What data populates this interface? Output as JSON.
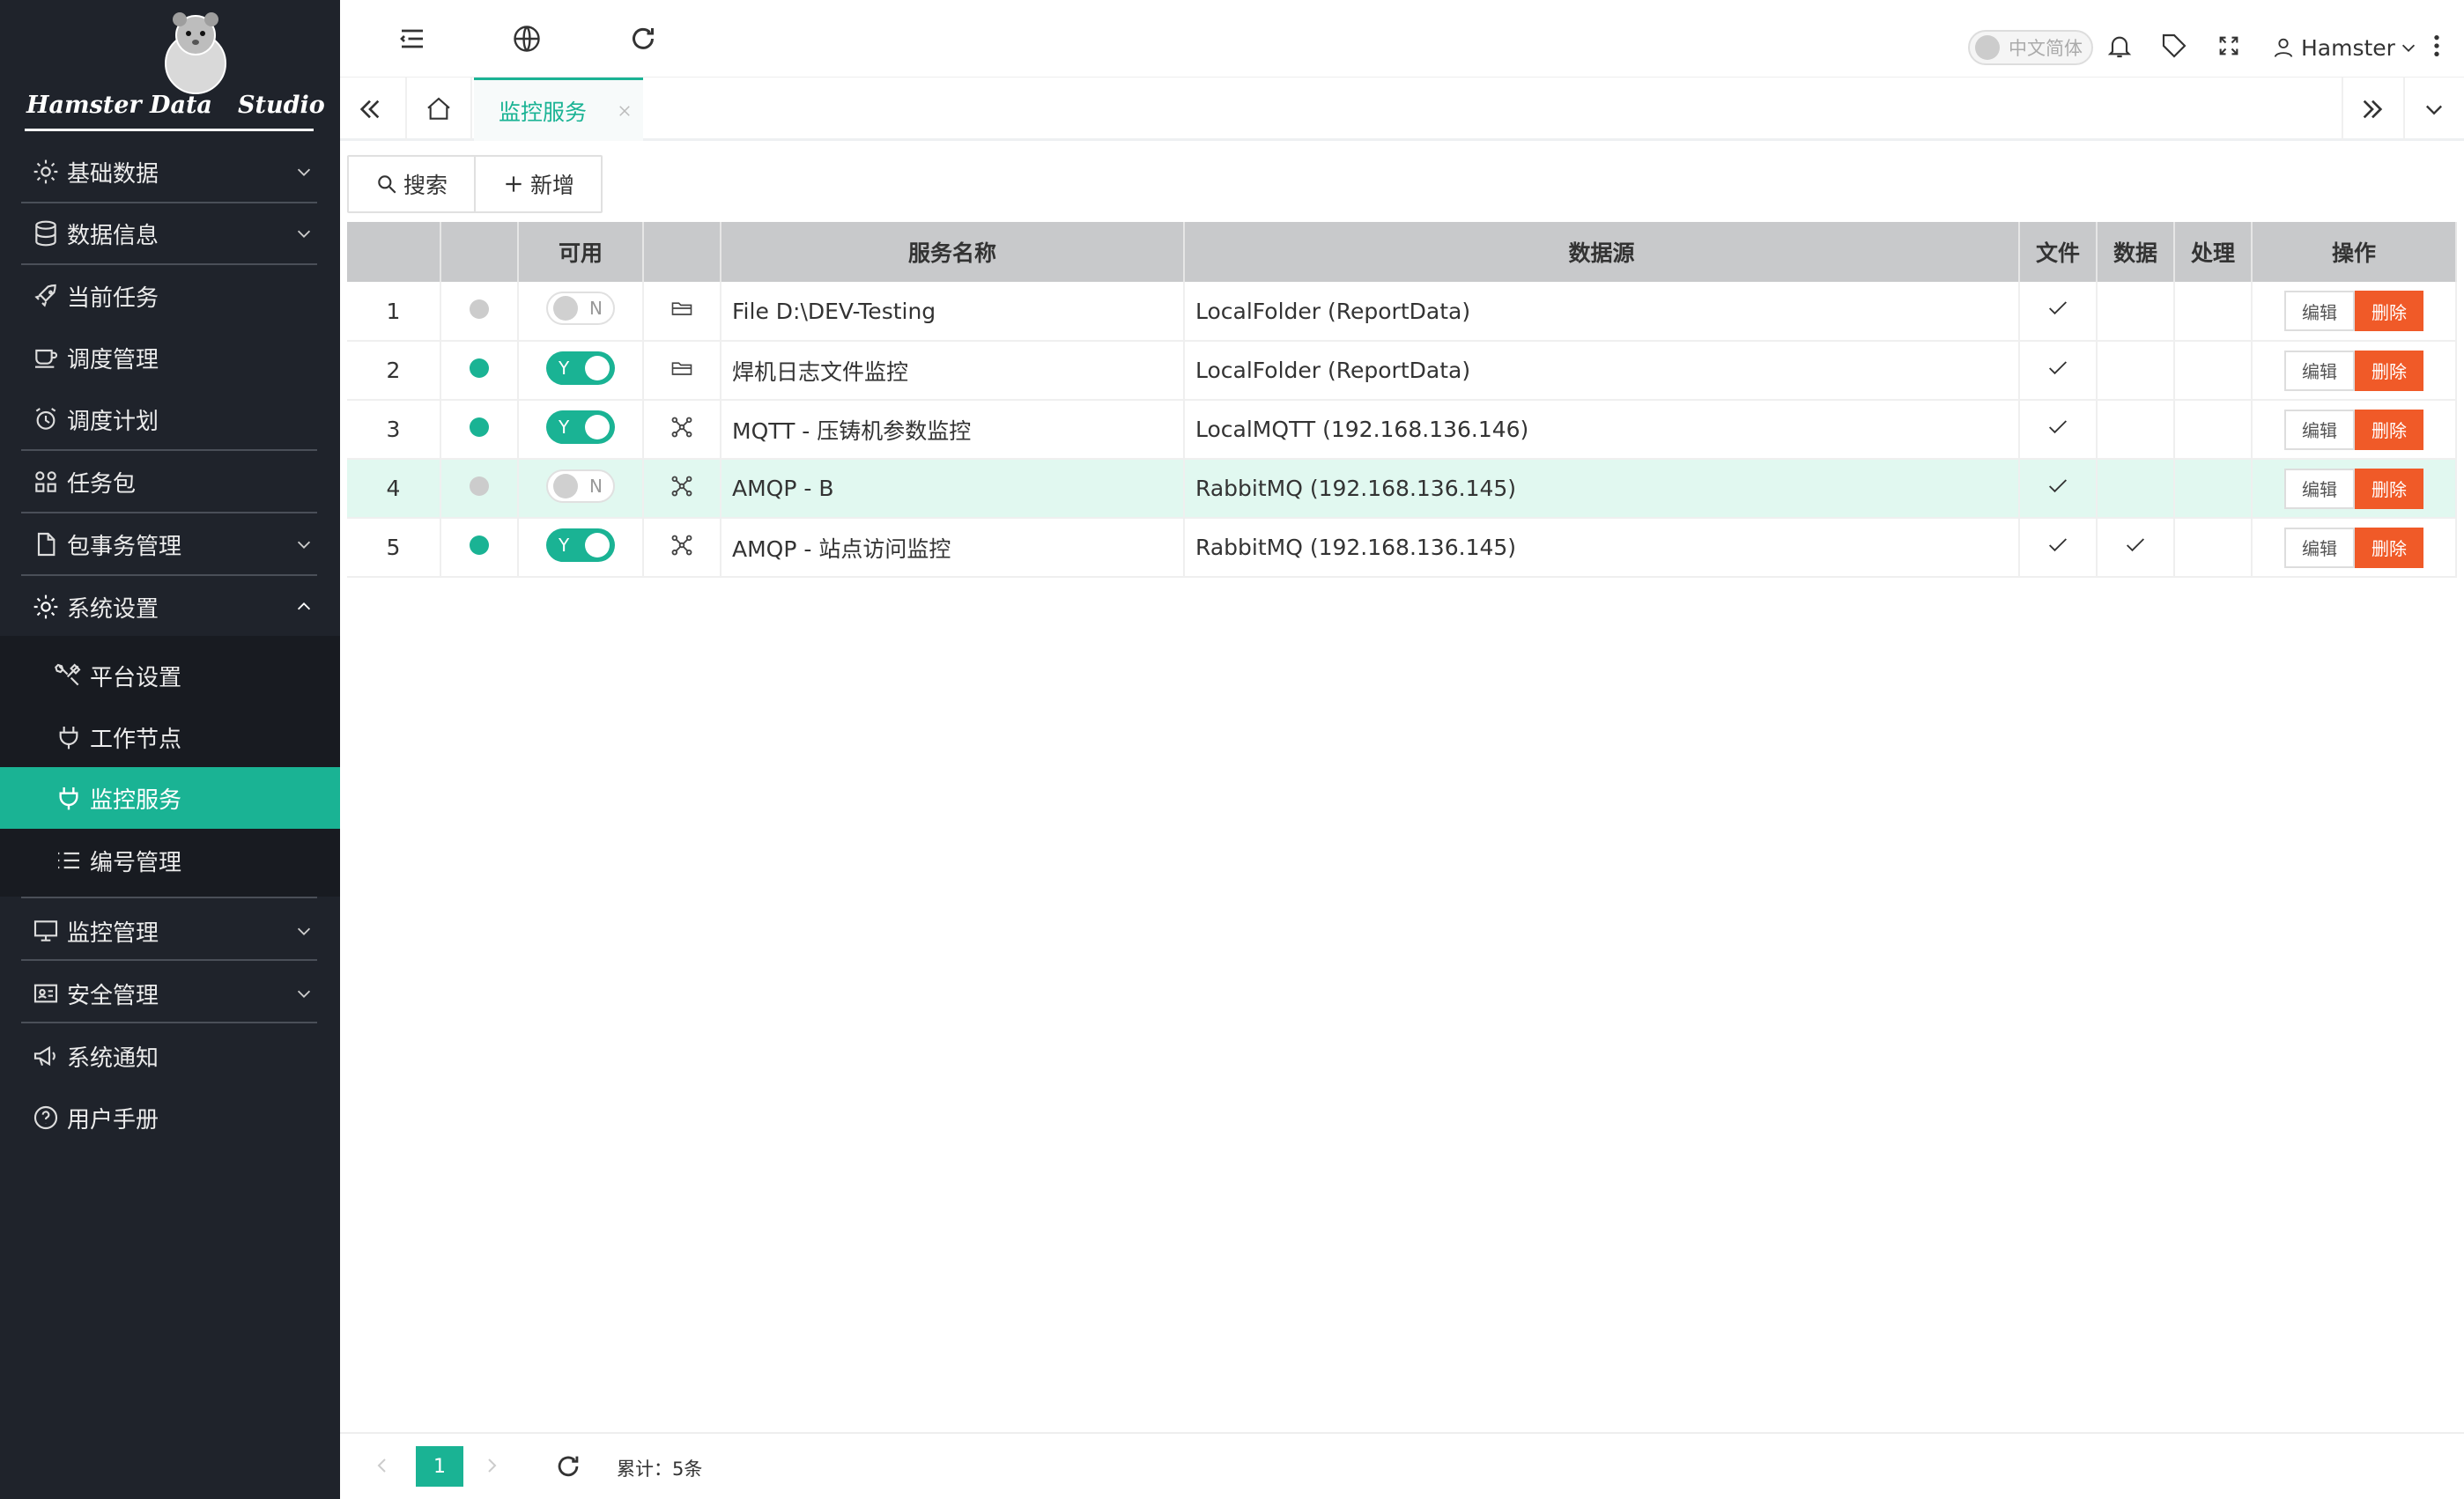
{
  "brand": {
    "logo_text_left": "Hamster Data",
    "logo_text_right": "Studio"
  },
  "sidebar": {
    "items": [
      {
        "label": "基础数据",
        "icon": "gear-icon",
        "expandable": true
      },
      {
        "label": "数据信息",
        "icon": "database-icon",
        "expandable": true
      },
      {
        "label": "当前任务",
        "icon": "rocket-icon",
        "expandable": false
      },
      {
        "label": "调度管理",
        "icon": "cup-icon",
        "expandable": false
      },
      {
        "label": "调度计划",
        "icon": "alarm-clock-icon",
        "expandable": false
      },
      {
        "label": "任务包",
        "icon": "grid-icon",
        "expandable": false
      },
      {
        "label": "包事务管理",
        "icon": "file-icon",
        "expandable": true
      },
      {
        "label": "系统设置",
        "icon": "gear-icon",
        "expandable": true,
        "expanded": true
      },
      {
        "label": "平台设置",
        "icon": "tools-icon",
        "sub": true
      },
      {
        "label": "工作节点",
        "icon": "plug-icon",
        "sub": true
      },
      {
        "label": "监控服务",
        "icon": "plug-icon",
        "sub": true,
        "active": true
      },
      {
        "label": "编号管理",
        "icon": "list-icon",
        "sub": true
      },
      {
        "label": "监控管理",
        "icon": "monitor-icon",
        "expandable": true
      },
      {
        "label": "安全管理",
        "icon": "id-card-icon",
        "expandable": true
      },
      {
        "label": "系统通知",
        "icon": "megaphone-icon",
        "expandable": false
      },
      {
        "label": "用户手册",
        "icon": "question-circle-icon",
        "expandable": false
      }
    ]
  },
  "header": {
    "language_toggle": "中文简体",
    "user_name": "Hamster"
  },
  "tabs": [
    {
      "label": "监控服务",
      "active": true,
      "closable": true
    }
  ],
  "toolbar": {
    "search_label": "搜索",
    "add_label": "新增"
  },
  "table": {
    "headers": [
      "",
      "",
      "可用",
      "",
      "服务名称",
      "数据源",
      "文件",
      "数据",
      "处理",
      "操作"
    ],
    "rows": [
      {
        "no": "1",
        "online": false,
        "enabled": false,
        "switch_text": "N",
        "type_icon": "folder-icon",
        "name": "File D:\\DEV-Testing",
        "source": "LocalFolder (ReportData)",
        "file": true,
        "data": false,
        "process": false,
        "highlight": false
      },
      {
        "no": "2",
        "online": true,
        "enabled": true,
        "switch_text": "Y",
        "type_icon": "folder-icon",
        "name": "焊机日志文件监控",
        "source": "LocalFolder (ReportData)",
        "file": true,
        "data": false,
        "process": false,
        "highlight": false
      },
      {
        "no": "3",
        "online": true,
        "enabled": true,
        "switch_text": "Y",
        "type_icon": "network-icon",
        "name": "MQTT - 压铸机参数监控",
        "source": "LocalMQTT (192.168.136.146)",
        "file": true,
        "data": false,
        "process": false,
        "highlight": false
      },
      {
        "no": "4",
        "online": false,
        "enabled": false,
        "switch_text": "N",
        "type_icon": "network-icon",
        "name": "AMQP - B",
        "source": "RabbitMQ (192.168.136.145)",
        "file": true,
        "data": false,
        "process": false,
        "highlight": true
      },
      {
        "no": "5",
        "online": true,
        "enabled": true,
        "switch_text": "Y",
        "type_icon": "network-icon",
        "name": "AMQP - 站点访问监控",
        "source": "RabbitMQ (192.168.136.145)",
        "file": true,
        "data": true,
        "process": false,
        "highlight": false
      }
    ],
    "edit_label": "编辑",
    "delete_label": "删除"
  },
  "pager": {
    "current_page": "1",
    "total_label": "累计：5条"
  },
  "colors": {
    "accent": "#1ab394",
    "sidebar_bg": "#1f232b",
    "danger": "#f05a28",
    "row_highlight": "#e1f8f0",
    "offline_dot": "#cccccc"
  }
}
